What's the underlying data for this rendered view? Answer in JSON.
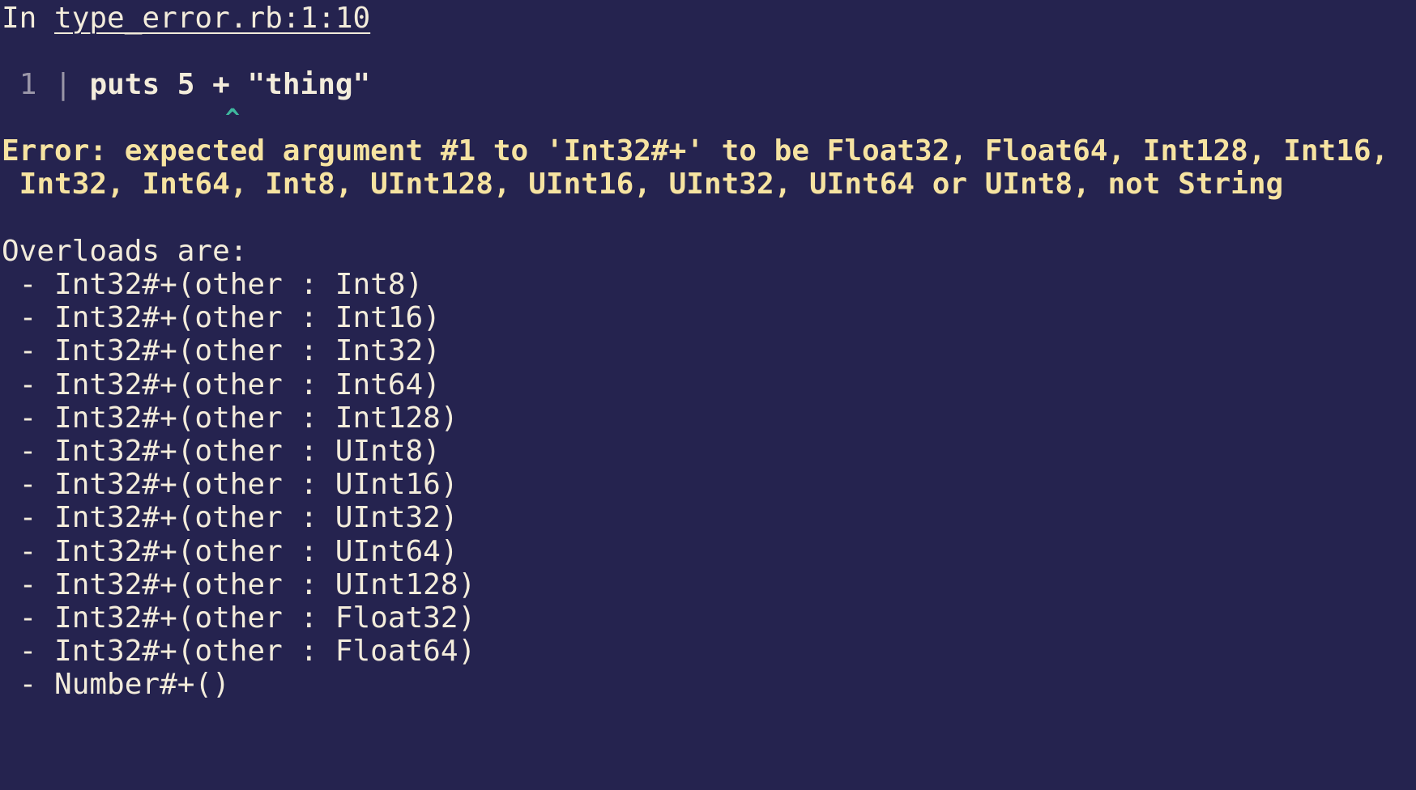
{
  "header": {
    "prefix": "In ",
    "location": "type_error.rb:1:10"
  },
  "source": {
    "line_number": "1",
    "separator": "|",
    "code": "puts 5 + \"thing\"",
    "caret": "^"
  },
  "error": {
    "line1": "Error: expected argument #1 to 'Int32#+' to be Float32, Float64, Int128, Int16,",
    "line2": " Int32, Int64, Int8, UInt128, UInt16, UInt32, UInt64 or UInt8, not String"
  },
  "overloads": {
    "heading": "Overloads are:",
    "items": [
      " - Int32#+(other : Int8)",
      " - Int32#+(other : Int16)",
      " - Int32#+(other : Int32)",
      " - Int32#+(other : Int64)",
      " - Int32#+(other : Int128)",
      " - Int32#+(other : UInt8)",
      " - Int32#+(other : UInt16)",
      " - Int32#+(other : UInt32)",
      " - Int32#+(other : UInt64)",
      " - Int32#+(other : UInt128)",
      " - Int32#+(other : Float32)",
      " - Int32#+(other : Float64)",
      " - Number#+()"
    ]
  },
  "colors": {
    "background": "#25234f",
    "text": "#f3ecdb",
    "error": "#f6e3a1",
    "caret": "#3fb89e",
    "gutter": "#9a96a8"
  }
}
